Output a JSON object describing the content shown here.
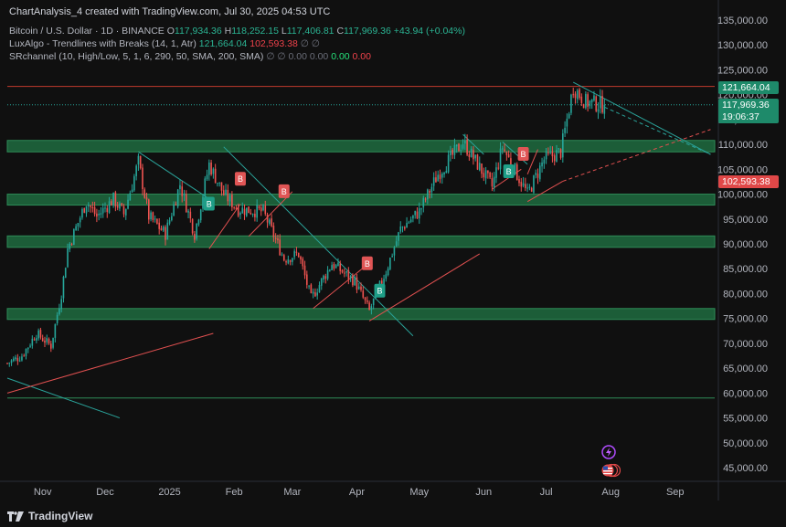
{
  "header": {
    "title": "ChartAnalysis_4 created with TradingView.com, Jul 30, 2025 04:53 UTC"
  },
  "legend": {
    "symbol": "Bitcoin / U.S. Dollar · 1D · BINANCE",
    "o_label": "O",
    "o": "117,934.36",
    "h_label": "H",
    "h": "118,252.15",
    "l_label": "L",
    "l": "117,406.81",
    "c_label": "C",
    "c": "117,969.36",
    "change": "+43.94 (+0.04%)",
    "lux_name": "LuxAlgo - Trendlines with Breaks (14, 1, Atr)",
    "lux_v1": "121,664.04",
    "lux_v2": "102,593.38",
    "sr_name": "SRchannel (10, High/Low, 5, 1, 6, 290, 50, SMA, 200, SMA)",
    "sr_v1": "0.00",
    "sr_v2": "0.00",
    "sr_v3": "0.00",
    "sr_v4": "0.00"
  },
  "price_tags": {
    "upper": "121,664.04",
    "last": "117,969.36",
    "countdown": "19:06:37",
    "lower": "102,593.38"
  },
  "footer": {
    "brand": "TradingView"
  },
  "icons": [
    "bolt-icon",
    "us-flag-icon",
    "tradingview-logo-icon"
  ],
  "colors": {
    "up": "#26a69a",
    "down": "#ef5350",
    "zone": "#1e6b3f",
    "zone_edge": "#2e8b57",
    "background": "#101010"
  },
  "chart_data": {
    "type": "candlestick",
    "ylim": [
      45000,
      135000
    ],
    "y_ticks": [
      45000,
      50000,
      55000,
      60000,
      65000,
      70000,
      75000,
      80000,
      85000,
      90000,
      95000,
      100000,
      105000,
      110000,
      115000,
      120000,
      125000,
      130000,
      135000
    ],
    "y_tick_labels": [
      "45,000.00",
      "50,000.00",
      "55,000.00",
      "60,000.00",
      "65,000.00",
      "70,000.00",
      "75,000.00",
      "80,000.00",
      "85,000.00",
      "90,000.00",
      "95,000.00",
      "100,000.00",
      "105,000.00",
      "110,000.00",
      "115,000.00",
      "120,000.00",
      "125,000.00",
      "130,000.00",
      "135,000.00"
    ],
    "x_labels": [
      "Nov",
      "Dec",
      "2025",
      "Feb",
      "Mar",
      "Apr",
      "May",
      "Jun",
      "Jul",
      "Aug",
      "Sep"
    ],
    "x_label_dates": [
      "2024-11-01",
      "2024-12-01",
      "2025-01-01",
      "2025-02-01",
      "2025-03-01",
      "2025-04-01",
      "2025-05-01",
      "2025-06-01",
      "2025-07-01",
      "2025-08-01",
      "2025-09-01"
    ],
    "x_range": [
      "2024-10-15",
      "2025-09-20"
    ],
    "price_path": [
      [
        "2024-10-15",
        66000
      ],
      [
        "2024-10-22",
        67500
      ],
      [
        "2024-10-29",
        72000
      ],
      [
        "2024-11-05",
        69500
      ],
      [
        "2024-11-10",
        80000
      ],
      [
        "2024-11-13",
        89000
      ],
      [
        "2024-11-22",
        98500
      ],
      [
        "2024-11-27",
        95500
      ],
      [
        "2024-12-05",
        99000
      ],
      [
        "2024-12-10",
        96000
      ],
      [
        "2024-12-17",
        106500
      ],
      [
        "2024-12-22",
        95500
      ],
      [
        "2024-12-30",
        92000
      ],
      [
        "2025-01-06",
        102000
      ],
      [
        "2025-01-13",
        92000
      ],
      [
        "2025-01-20",
        106000
      ],
      [
        "2025-01-27",
        100000
      ],
      [
        "2025-02-03",
        97000
      ],
      [
        "2025-02-15",
        96500
      ],
      [
        "2025-02-25",
        87000
      ],
      [
        "2025-03-04",
        88000
      ],
      [
        "2025-03-10",
        79000
      ],
      [
        "2025-03-20",
        86000
      ],
      [
        "2025-03-31",
        82500
      ],
      [
        "2025-04-07",
        76500
      ],
      [
        "2025-04-15",
        84500
      ],
      [
        "2025-04-22",
        93000
      ],
      [
        "2025-05-01",
        96500
      ],
      [
        "2025-05-10",
        104000
      ],
      [
        "2025-05-22",
        110500
      ],
      [
        "2025-06-05",
        101500
      ],
      [
        "2025-06-10",
        109500
      ],
      [
        "2025-06-22",
        100000
      ],
      [
        "2025-06-30",
        107000
      ],
      [
        "2025-07-08",
        108500
      ],
      [
        "2025-07-14",
        121500
      ],
      [
        "2025-07-20",
        118500
      ],
      [
        "2025-07-29",
        117969
      ]
    ],
    "last_close": 117969.36,
    "sr_zones": [
      {
        "low": 108500,
        "high": 110800
      },
      {
        "low": 97800,
        "high": 100000
      },
      {
        "low": 89300,
        "high": 91600
      },
      {
        "low": 74800,
        "high": 77000
      }
    ],
    "support_line": 59000,
    "resistance_line": 121664.04,
    "last_price_line": 117969.36,
    "breaks": [
      {
        "label": "B",
        "date": "2025-01-20",
        "price": 98000,
        "type": "bull"
      },
      {
        "label": "B",
        "date": "2025-02-04",
        "price": 103000,
        "type": "bear"
      },
      {
        "label": "B",
        "date": "2025-02-25",
        "price": 100500,
        "type": "bear"
      },
      {
        "label": "B",
        "date": "2025-04-06",
        "price": 86000,
        "type": "bear"
      },
      {
        "label": "B",
        "date": "2025-04-12",
        "price": 80500,
        "type": "bull"
      },
      {
        "label": "B",
        "date": "2025-06-13",
        "price": 104500,
        "type": "bull"
      },
      {
        "label": "B",
        "date": "2025-06-20",
        "price": 108000,
        "type": "bear"
      }
    ],
    "trendlines": [
      {
        "kind": "down",
        "from": [
          "2024-10-15",
          63000
        ],
        "to": [
          "2024-12-08",
          55000
        ]
      },
      {
        "kind": "up",
        "from": [
          "2024-10-15",
          60000
        ],
        "to": [
          "2025-01-22",
          72000
        ]
      },
      {
        "kind": "down",
        "from": [
          "2024-12-17",
          108500
        ],
        "to": [
          "2025-01-22",
          98500
        ]
      },
      {
        "kind": "up",
        "from": [
          "2025-01-20",
          89000
        ],
        "to": [
          "2025-02-04",
          98000
        ]
      },
      {
        "kind": "down",
        "from": [
          "2025-01-27",
          109500
        ],
        "to": [
          "2025-04-28",
          71500
        ]
      },
      {
        "kind": "up",
        "from": [
          "2025-02-08",
          91500
        ],
        "to": [
          "2025-03-01",
          100500
        ]
      },
      {
        "kind": "up",
        "from": [
          "2025-03-11",
          77000
        ],
        "to": [
          "2025-04-05",
          85500
        ]
      },
      {
        "kind": "up",
        "from": [
          "2025-04-07",
          74500
        ],
        "to": [
          "2025-05-30",
          88000
        ]
      },
      {
        "kind": "down",
        "from": [
          "2025-05-22",
          112000
        ],
        "to": [
          "2025-06-01",
          108000
        ]
      },
      {
        "kind": "up",
        "from": [
          "2025-06-05",
          101000
        ],
        "to": [
          "2025-06-19",
          105000
        ]
      },
      {
        "kind": "down",
        "from": [
          "2025-06-10",
          110500
        ],
        "to": [
          "2025-06-22",
          106000
        ]
      },
      {
        "kind": "up",
        "from": [
          "2025-06-22",
          98500
        ],
        "to": [
          "2025-07-09",
          102593.38
        ]
      },
      {
        "kind": "up",
        "from": [
          "2025-06-22",
          104000
        ],
        "to": [
          "2025-06-27",
          109000
        ]
      },
      {
        "kind": "down",
        "from": [
          "2025-07-14",
          122500
        ],
        "to": [
          "2025-09-18",
          108000
        ]
      }
    ],
    "projections": [
      {
        "kind": "down",
        "from": [
          "2025-07-29",
          117500
        ],
        "to": [
          "2025-09-18",
          108000
        ]
      },
      {
        "kind": "up",
        "from": [
          "2025-07-09",
          102593
        ],
        "to": [
          "2025-09-18",
          113000
        ]
      }
    ]
  }
}
